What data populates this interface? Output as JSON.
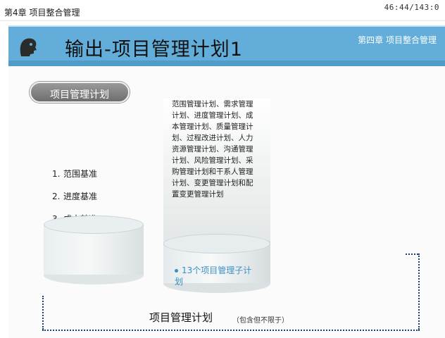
{
  "header": {
    "chapter_label": "第4章 项目整合管理",
    "page_counter": "46:44/143:0"
  },
  "banner": {
    "title": "输出-项目管理计划1",
    "chapter": "第四章 项目整合管理"
  },
  "section_pill": "项目管理计划",
  "baselines": [
    {
      "num": "1.",
      "label": "范围基准"
    },
    {
      "num": "2.",
      "label": "进度基准"
    },
    {
      "num": "3.",
      "label": "成本基准"
    }
  ],
  "plans_description": "范围管理计划、需求管理计划、进度管理计划、成本管理计划、质量管理计划、过程改进计划、人力资源管理计划、沟通管理计划、风险管理计划、采购管理计划和干系人管理计划、变更管理计划和配置变更管理计划",
  "sub_plans": "13个项目管理子计划",
  "footer": {
    "title": "项目管理计划",
    "note": "（包含但不限于）"
  },
  "colors": {
    "banner_blue": "#62add9",
    "accent_blue": "#3b8fc4",
    "dotted_navy": "#1b3f7a"
  },
  "icons": [
    "logo-head-icon"
  ]
}
